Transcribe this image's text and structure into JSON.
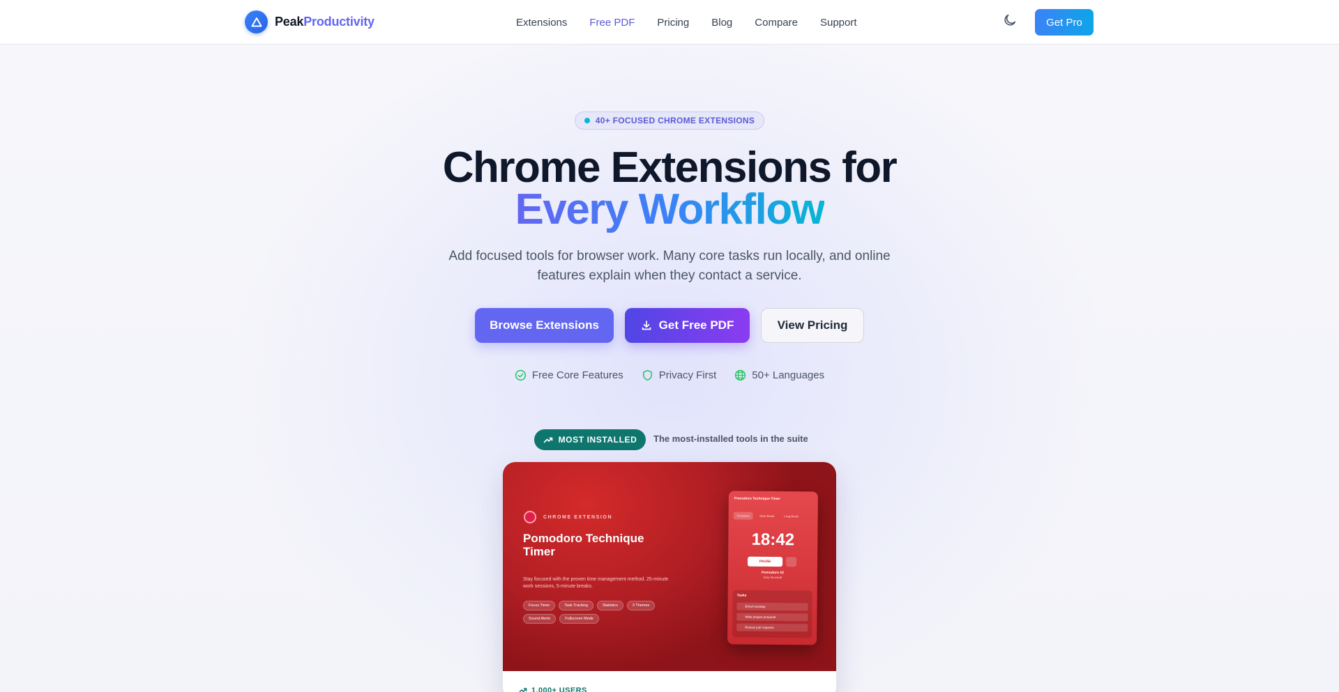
{
  "brand": {
    "name_a": "Peak",
    "name_b": "Productivity"
  },
  "nav": {
    "links": [
      "Extensions",
      "Free PDF",
      "Pricing",
      "Blog",
      "Compare",
      "Support"
    ],
    "cta": "Get Pro"
  },
  "hero": {
    "pill": "40+ FOCUSED CHROME EXTENSIONS",
    "title_line1": "Chrome Extensions for",
    "title_line2": "Every Workflow",
    "subtitle": "Add focused tools for browser work. Many core tasks run locally, and online features explain when they contact a service.",
    "buttons": {
      "browse": "Browse Extensions",
      "pdf": "Get Free PDF",
      "pricing": "View Pricing"
    },
    "features": [
      "Free Core Features",
      "Privacy First",
      "50+ Languages"
    ]
  },
  "most_installed": {
    "badge": "MOST INSTALLED",
    "caption": "The most-installed tools in the suite"
  },
  "card": {
    "category": "CHROME EXTENSION",
    "title": "Pomodoro Technique Timer",
    "description": "Stay focused with the proven time management method. 25-minute work sessions, 5-minute breaks.",
    "chips": [
      "Focus Timer",
      "Task Tracking",
      "Statistics",
      "3 Themes",
      "Sound Alerts",
      "Fullscreen Mode"
    ],
    "mockup": {
      "header": "Pomodoro Technique Timer",
      "tabs": [
        "Pomodoro",
        "Short Break",
        "Long Break"
      ],
      "time": "18:42",
      "pause": "PAUSE",
      "pomodoro": "Pomodoro #2",
      "focus": "Stay focused!",
      "tasks_title": "Tasks",
      "tasks": [
        "Email roundup",
        "Write project proposal",
        "Review pull requests"
      ]
    },
    "users": "1,000+ USERS"
  },
  "colors": {
    "accent": "#6366f1",
    "brand_blue": "#3b82f6",
    "teal": "#0f766e",
    "card_red": "#b01e24"
  }
}
